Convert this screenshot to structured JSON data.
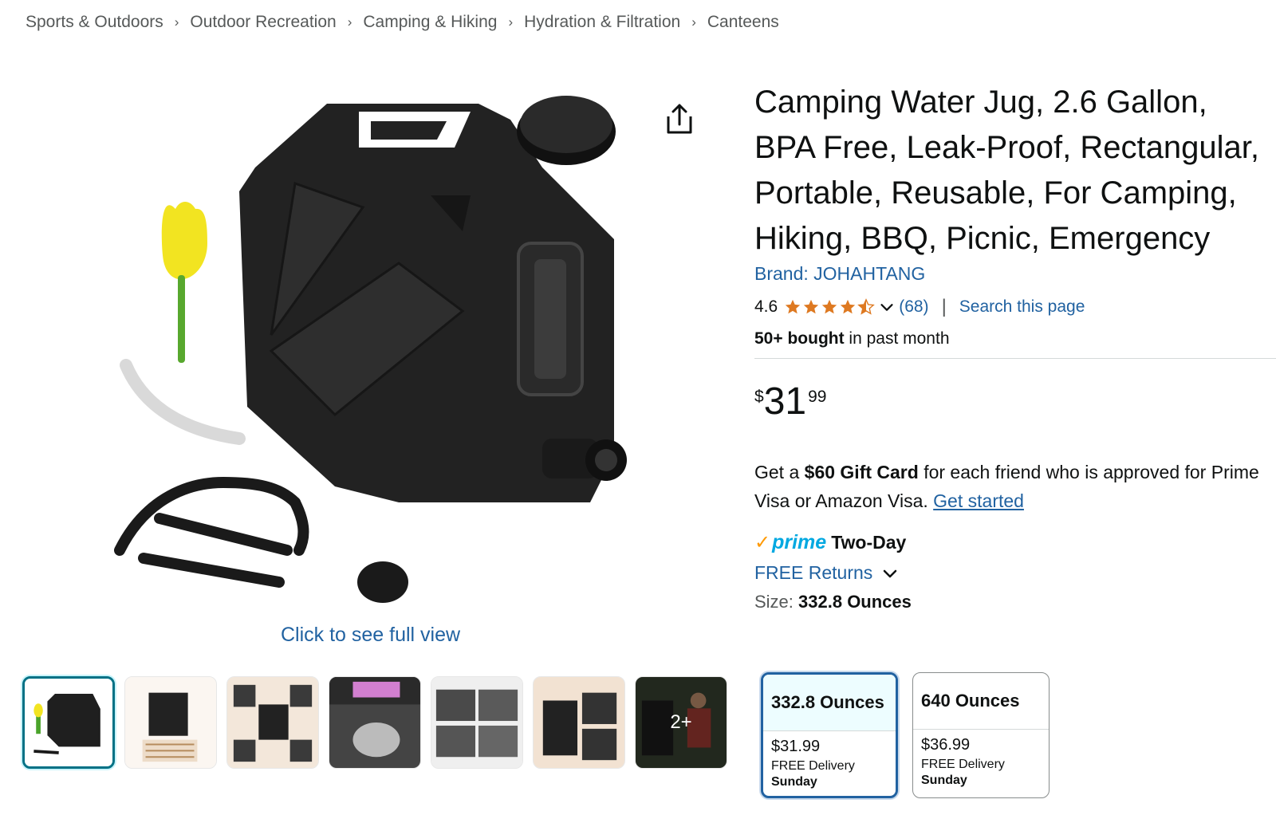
{
  "breadcrumb": [
    "Sports & Outdoors",
    "Outdoor Recreation",
    "Camping & Hiking",
    "Hydration & Filtration",
    "Canteens"
  ],
  "breadcrumb_separator": "›",
  "image": {
    "full_view_label": "Click to see full view",
    "more_thumbnails_label": "2+"
  },
  "product": {
    "title": "Camping Water Jug, 2.6 Gallon, BPA Free, Leak-Proof, Rectangular, Portable, Reusable, For Camping, Hiking, BBQ, Picnic, Emergency",
    "brand": "Brand: JOHAHTANG",
    "rating": "4.6",
    "stars": 4.5,
    "rating_count": "(68)",
    "rating_divider": "|",
    "search_page": "Search this page",
    "bought_bold": "50+ bought",
    "bought_rest": " in past month"
  },
  "price": {
    "symbol": "$",
    "whole": "31",
    "fraction": "99"
  },
  "promo": {
    "prefix": "Get a ",
    "bold": "$60 Gift Card",
    "suffix": " for each friend who is approved for Prime Visa or Amazon Visa. ",
    "link": "Get started"
  },
  "prime": {
    "check": "✓",
    "logo": "prime",
    "label": "Two-Day"
  },
  "returns": {
    "label": "FREE Returns"
  },
  "size": {
    "label": "Size: ",
    "selected": "332.8 Ounces",
    "options": [
      {
        "name": "332.8 Ounces",
        "price": "$31.99",
        "delivery": "FREE Delivery",
        "day": "Sunday"
      },
      {
        "name": "640 Ounces",
        "price": "$36.99",
        "delivery": "FREE Delivery",
        "day": "Sunday"
      }
    ]
  },
  "colors": {
    "link": "#2162a1",
    "star": "#de7921",
    "prime_blue": "#00a8e1",
    "prime_orange": "#ff9900",
    "selected_border": "#007185"
  }
}
